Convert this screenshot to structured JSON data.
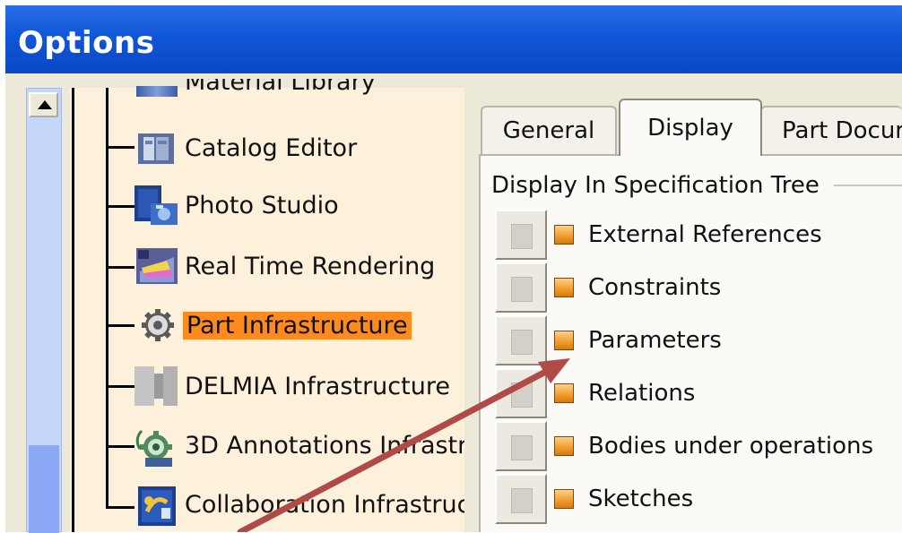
{
  "window": {
    "title": "Options"
  },
  "tree": {
    "partial_item": "Material Library",
    "items": [
      {
        "label": "Catalog Editor",
        "icon": "catalog-editor-icon"
      },
      {
        "label": "Photo Studio",
        "icon": "photo-studio-icon"
      },
      {
        "label": "Real Time Rendering",
        "icon": "real-time-rendering-icon"
      },
      {
        "label": "Part Infrastructure",
        "icon": "gear-icon",
        "selected": true
      },
      {
        "label": "DELMIA Infrastructure",
        "icon": "delmia-icon"
      },
      {
        "label": "3D Annotations Infrastr",
        "icon": "annotations-icon"
      },
      {
        "label": "Collaboration Infrastruc",
        "icon": "collaboration-icon"
      }
    ]
  },
  "tabs": [
    {
      "label": "General",
      "active": false
    },
    {
      "label": "Display",
      "active": true
    },
    {
      "label": "Part Docur",
      "active": false
    }
  ],
  "display_group": {
    "title": "Display In Specification Tree",
    "options": [
      {
        "label": "External References",
        "checked": true
      },
      {
        "label": "Constraints",
        "checked": true
      },
      {
        "label": "Parameters",
        "checked": true
      },
      {
        "label": "Relations",
        "checked": true
      },
      {
        "label": "Bodies under operations",
        "checked": true
      },
      {
        "label": "Sketches",
        "checked": true
      }
    ]
  },
  "colors": {
    "titlebar": "#0f56d8",
    "selection": "#ff8a1e",
    "arrow": "#b04a48",
    "tree_bg": "#fdf1dc"
  }
}
